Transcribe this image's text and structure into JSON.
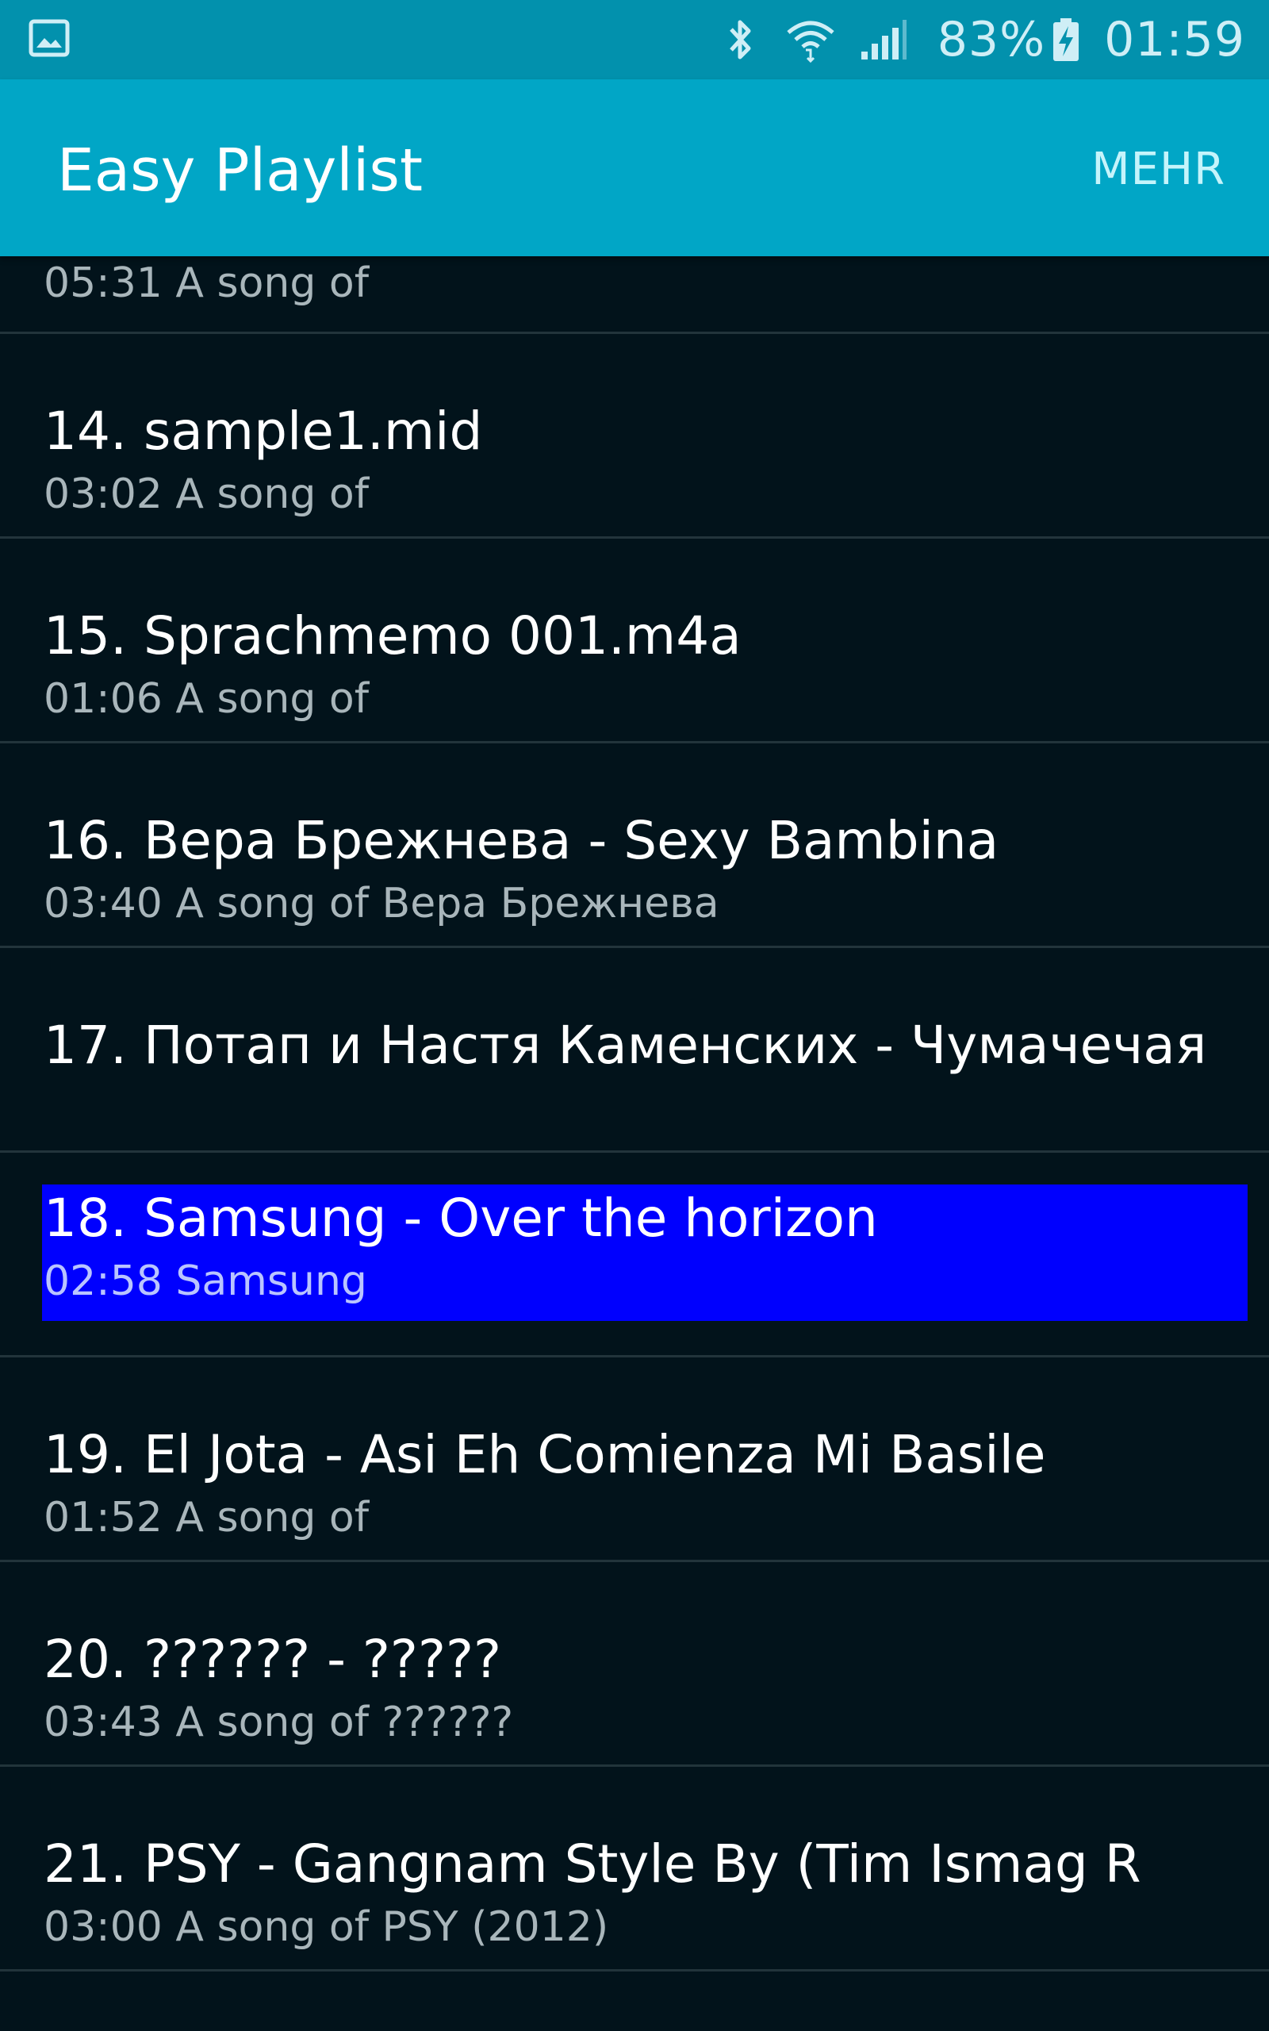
{
  "status_bar": {
    "battery": "83%",
    "time": "01:59",
    "icons": [
      "gallery-icon",
      "bluetooth-icon",
      "wifi-icon",
      "signal-icon",
      "battery-charging-icon"
    ]
  },
  "action_bar": {
    "title": "Easy Playlist",
    "more_label": "MEHR",
    "background": "#01a6c6"
  },
  "playlist": {
    "partial_item": {
      "subtitle": "05:31 A song of"
    },
    "items": [
      {
        "title": "14. sample1.mid",
        "subtitle": "03:02 A song of"
      },
      {
        "title": "15. Sprachmemo 001.m4a",
        "subtitle": "01:06 A song of"
      },
      {
        "title": "16. Вера Брежнева - Sexy Bambina",
        "subtitle": "03:40 A song of Вера Брежнева"
      },
      {
        "title": "17. Потап и Настя Каменских - Чумачечая",
        "subtitle": ""
      },
      {
        "title": "18. Samsung - Over the horizon",
        "subtitle": "02:58 Samsung",
        "selected": true
      },
      {
        "title": "19. El Jota - Asi Eh Comienza Mi Basile",
        "subtitle": "01:52 A song of"
      },
      {
        "title": "20. ?????? - ?????",
        "subtitle": "03:43 A song of ??????"
      },
      {
        "title": "21. PSY - Gangnam Style By (Tim Ismag R",
        "subtitle": "03:00 A song of PSY (2012)"
      }
    ],
    "selected_color": "#0000fe",
    "background": "#02131b"
  }
}
